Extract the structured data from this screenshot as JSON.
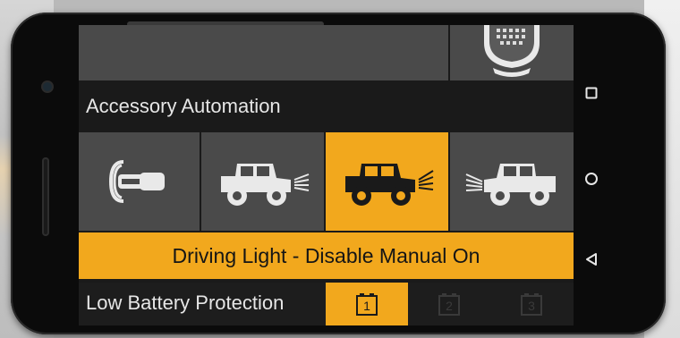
{
  "section": {
    "accessory_automation_title": "Accessory Automation",
    "low_battery_title": "Low Battery Protection"
  },
  "automation_tiles": [
    {
      "name": "ignition-key",
      "active": false
    },
    {
      "name": "rear-light",
      "active": false
    },
    {
      "name": "driving-light",
      "active": true
    },
    {
      "name": "front-light",
      "active": false
    }
  ],
  "status": {
    "label": "Driving Light - Disable Manual On"
  },
  "battery_levels": [
    {
      "label": "1",
      "active": true
    },
    {
      "label": "2",
      "active": false
    },
    {
      "label": "3",
      "active": false
    }
  ],
  "colors": {
    "accent": "#f2a81d",
    "tile": "#4a4a4a",
    "background": "#1a1a1a"
  }
}
